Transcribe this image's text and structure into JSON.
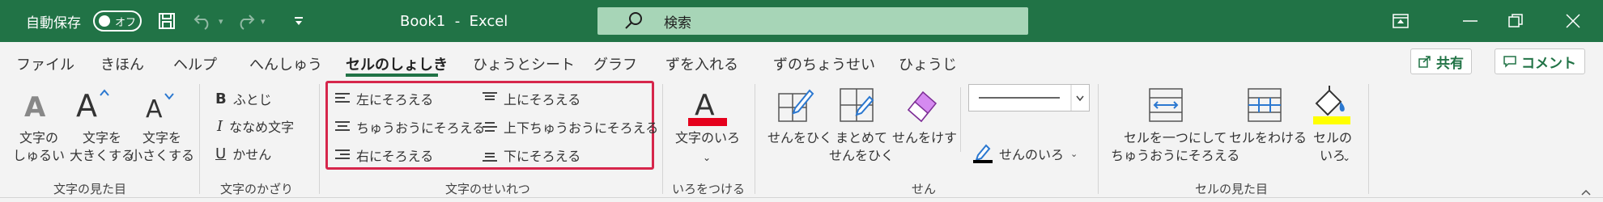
{
  "titlebar": {
    "autosave_label": "自動保存",
    "autosave_toggle": "オフ",
    "doc_title": "Book1  -  Excel",
    "search_placeholder": "検索"
  },
  "tabs": [
    {
      "label": "ファイル"
    },
    {
      "label": "きほん"
    },
    {
      "label": "ヘルプ"
    },
    {
      "label": "へんしゅう"
    },
    {
      "label": "セルのしょしき",
      "active": true
    },
    {
      "label": "ひょうとシート"
    },
    {
      "label": "グラフ"
    },
    {
      "label": "ずを入れる"
    },
    {
      "label": "ずのちょうせい"
    },
    {
      "label": "ひょうじ"
    }
  ],
  "top_buttons": {
    "share": "共有",
    "comment": "コメント"
  },
  "groups": {
    "text_appearance": {
      "label": "文字の見た目",
      "font_type": "文字の\nしゅるい",
      "grow_font": "文字を\n大きくする",
      "shrink_font": "文字を\n小さくする"
    },
    "text_decoration": {
      "label": "文字のかざり",
      "bold": "ふとじ",
      "italic": "ななめ文字",
      "underline": "かせん",
      "bold_glyph": "B",
      "italic_glyph": "I",
      "underline_glyph": "U"
    },
    "alignment": {
      "label": "文字のせいれつ",
      "left": "左にそろえる",
      "center": "ちゅうおうにそろえる",
      "right": "右にそろえる",
      "top": "上にそろえる",
      "middle": "上下ちゅうおうにそろえる",
      "bottom": "下にそろえる"
    },
    "color": {
      "label": "いろをつける",
      "font_color": "文字のいろ",
      "accent": "#e5001c"
    },
    "border": {
      "label": "せん",
      "draw": "せんをひく",
      "draw_all": "まとめて\nせんをひく",
      "erase": "せんをけす",
      "line_color": "せんのいろ"
    },
    "cell_appearance": {
      "label": "セルの見た目",
      "merge": "セルを一つにして\nちゅうおうにそろえる",
      "split": "セルをわける",
      "fill": "セルの\nいろ",
      "fill_color": "#ffff00"
    }
  },
  "colors": {
    "brand": "#217346",
    "highlight": "#d6264b"
  }
}
